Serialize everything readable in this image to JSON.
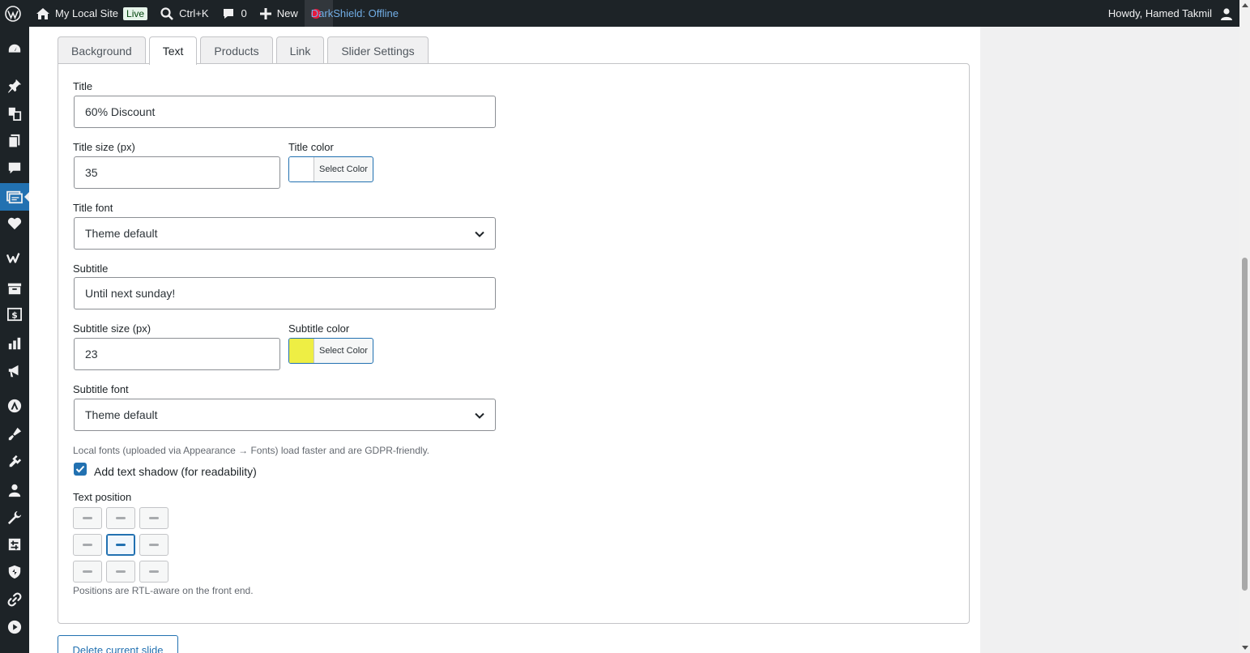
{
  "adminbar": {
    "site_name": "My Local Site",
    "live_badge": "Live",
    "search_shortcut": "Ctrl+K",
    "comments_count": "0",
    "new_label": "New",
    "darkshield_label": "DarkShield: Offline",
    "howdy": "Howdy, Hamed Takmil"
  },
  "sidebar": {
    "icons": [
      "dashboard-icon",
      "pin-icon",
      "media-icon",
      "pages-icon",
      "comments-icon",
      "slider-icon",
      "heart-icon",
      "woo-icon",
      "archive-icon",
      "dollar-icon",
      "stats-icon",
      "megaphone-icon",
      "astra-icon",
      "appearance-icon",
      "plugins-icon",
      "users-icon",
      "tools-icon",
      "settings-icon",
      "shield-icon",
      "link-icon",
      "play-icon"
    ],
    "active": "slider-icon"
  },
  "tabs": [
    {
      "label": "Background",
      "active": false
    },
    {
      "label": "Text",
      "active": true
    },
    {
      "label": "Products",
      "active": false
    },
    {
      "label": "Link",
      "active": false
    },
    {
      "label": "Slider Settings",
      "active": false
    }
  ],
  "form": {
    "title_label": "Title",
    "title_value": "60% Discount",
    "title_size_label": "Title size (px)",
    "title_size_value": "35",
    "title_color_label": "Title color",
    "title_color_button": "Select Color",
    "title_color_swatch": "#ffffff",
    "title_font_label": "Title font",
    "title_font_value": "Theme default",
    "subtitle_label": "Subtitle",
    "subtitle_value": "Until next sunday!",
    "subtitle_size_label": "Subtitle size (px)",
    "subtitle_size_value": "23",
    "subtitle_color_label": "Subtitle color",
    "subtitle_color_button": "Select Color",
    "subtitle_color_swatch": "#eeee44",
    "subtitle_font_label": "Subtitle font",
    "subtitle_font_value": "Theme default",
    "fonts_hint": "Local fonts (uploaded via Appearance → Fonts) load faster and are GDPR-friendly.",
    "shadow_label": "Add text shadow (for readability)",
    "shadow_checked": true,
    "position_label": "Text position",
    "position_selected": "middle-center",
    "position_hint": "Positions are RTL-aware on the front end."
  },
  "delete_button": "Delete current slide",
  "colors": {
    "accent": "#2271b1",
    "adminbar": "#1d2327"
  }
}
